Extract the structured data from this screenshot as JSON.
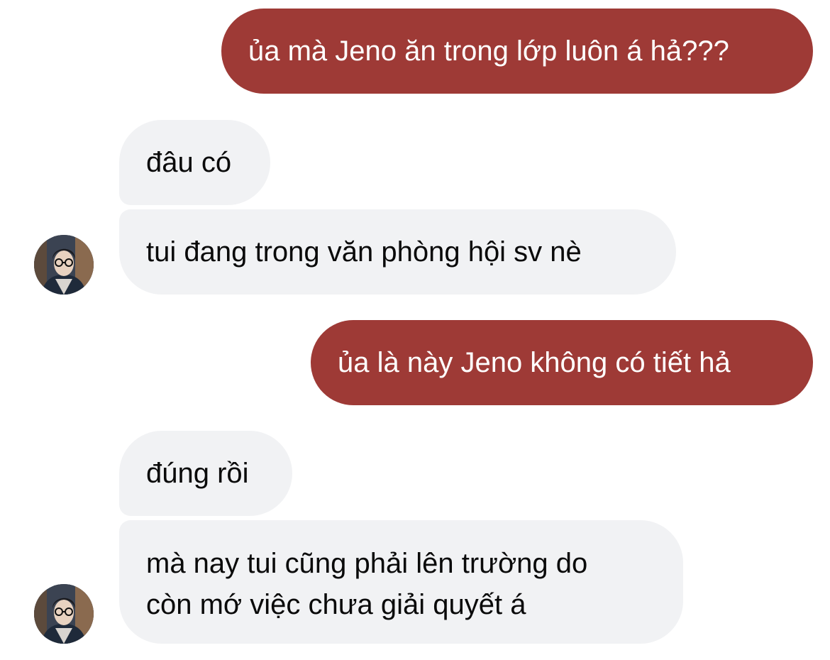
{
  "messages": [
    {
      "from": "me",
      "text": "ủa mà Jeno ăn trong lớp luôn á hả???"
    },
    {
      "from": "them",
      "text": "đâu có"
    },
    {
      "from": "them",
      "text": "tui đang trong văn phòng hội sv nè"
    },
    {
      "from": "me",
      "text": "ủa là này Jeno không có tiết hả"
    },
    {
      "from": "them",
      "text": "đúng rồi"
    },
    {
      "from": "them",
      "lines": [
        "mà nay tui cũng phải lên trường do",
        "còn mớ việc chưa giải quyết á"
      ]
    }
  ],
  "colors": {
    "outgoing_bubble": "#9e3a36",
    "incoming_bubble": "#f1f2f4",
    "outgoing_text": "#ffffff",
    "incoming_text": "#0a0a0a"
  },
  "icons": {
    "contact_avatar": "avatar-photo-person-with-glasses"
  }
}
